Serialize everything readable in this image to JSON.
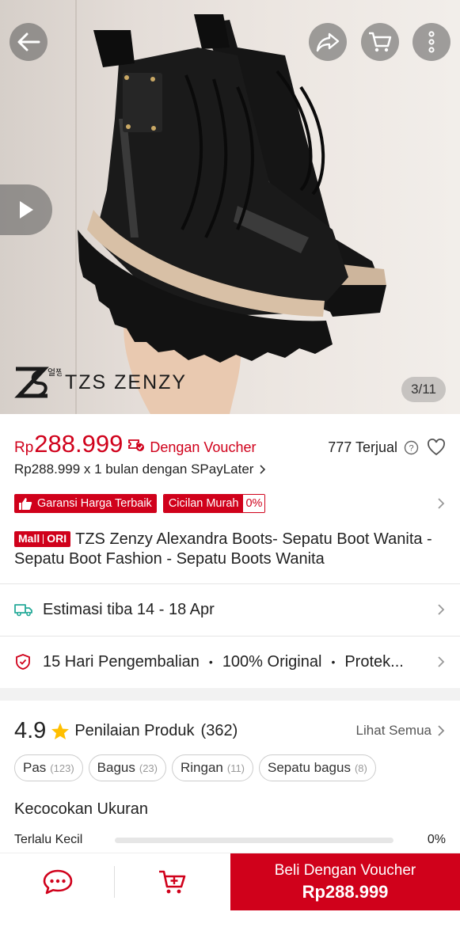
{
  "hero": {
    "image_counter": "3/11",
    "brand_name": "TZS ZENZY",
    "brand_korean": "얼찡",
    "icons": [
      "back-arrow-icon",
      "share-icon",
      "cart-icon",
      "more-icon",
      "play-icon"
    ]
  },
  "price": {
    "currency": "Rp",
    "amount": "288.999",
    "voucher_label": "Dengan Voucher",
    "sold": "777 Terjual",
    "paylater": "Rp288.999 x 1 bulan dengan SPayLater",
    "accent_color": "#d0011b"
  },
  "badges": {
    "best_price": "Garansi Harga Terbaik",
    "installment": "Cicilan Murah",
    "installment_rate": "0%"
  },
  "product": {
    "mall": "Mall",
    "ori": "ORI",
    "title": "TZS Zenzy Alexandra Boots- Sepatu Boot Wanita - Sepatu Boot Fashion - Sepatu Boots Wanita"
  },
  "shipping": {
    "estimate": "Estimasi tiba 14 - 18 Apr"
  },
  "guarantee": {
    "item1": "15 Hari Pengembalian",
    "item2": "100% Original",
    "item3": "Protek..."
  },
  "rating": {
    "score": "4.9",
    "label": "Penilaian Produk",
    "count": "(362)",
    "see_all": "Lihat Semua",
    "chips": [
      {
        "label": "Pas",
        "count": "(123)"
      },
      {
        "label": "Bagus",
        "count": "(23)"
      },
      {
        "label": "Ringan",
        "count": "(11)"
      },
      {
        "label": "Sepatu bagus",
        "count": "(8)"
      }
    ]
  },
  "fit": {
    "title": "Kecocokan Ukuran",
    "row_label": "Terlalu Kecil",
    "row_pct": "0%"
  },
  "bottom_bar": {
    "buy_label": "Beli Dengan Voucher",
    "buy_price": "Rp288.999",
    "icons": [
      "chat-icon",
      "add-to-cart-icon"
    ]
  }
}
